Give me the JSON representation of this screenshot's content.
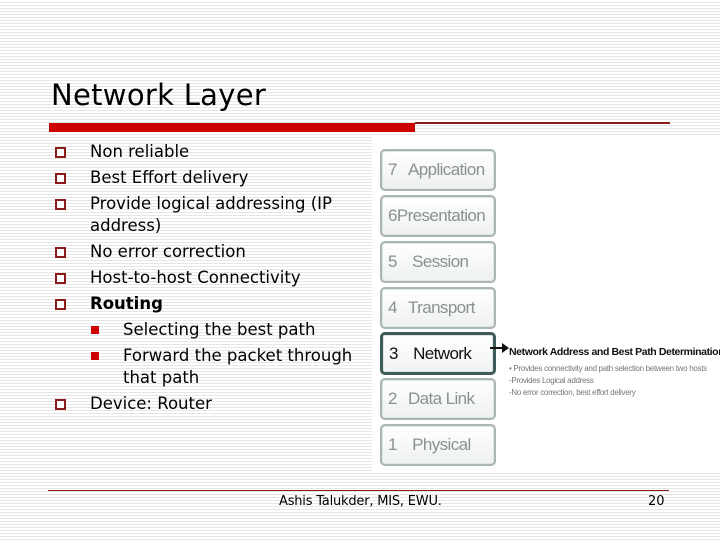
{
  "slide": {
    "title": "Network Layer",
    "bullets": [
      {
        "text": "Non reliable"
      },
      {
        "text": "Best Effort delivery"
      },
      {
        "text": "Provide logical addressing (IP address)"
      },
      {
        "text": "No error correction"
      },
      {
        "text": "Host-to-host Connectivity"
      },
      {
        "text": "Routing",
        "bold": true,
        "subitems": [
          "Selecting the best path",
          "Forward the packet through that path"
        ]
      },
      {
        "text": "Device: Router"
      }
    ],
    "bullet_icon": "hollow-square",
    "subbullet_icon": "filled-square",
    "accent_color": "#cc0000"
  },
  "figure": {
    "layers": [
      {
        "num": "7",
        "name": "Application"
      },
      {
        "num": "6",
        "name": "Presentation"
      },
      {
        "num": "5",
        "name": "Session"
      },
      {
        "num": "4",
        "name": "Transport"
      },
      {
        "num": "3",
        "name": "Network",
        "active": true
      },
      {
        "num": "2",
        "name": "Data Link"
      },
      {
        "num": "1",
        "name": "Physical"
      }
    ],
    "description_title": "Network Address and Best Path Determination",
    "description_lines": [
      "• Provides connectivity and path selection between two hosts",
      "-Provides Logical address",
      "-No error correction, best effort delivery"
    ]
  },
  "footer": {
    "text": "Ashis Talukder, MIS, EWU.",
    "page_number": "20"
  }
}
